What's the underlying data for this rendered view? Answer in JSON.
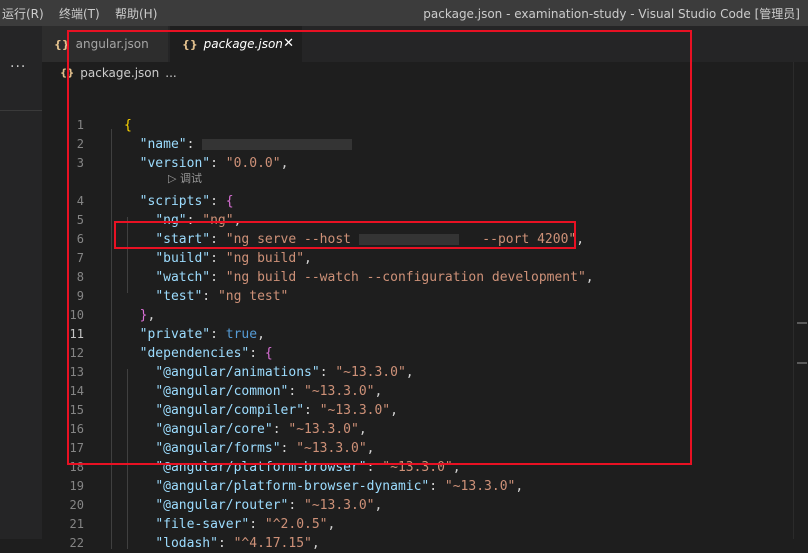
{
  "menubar": {
    "run": "运行(R)",
    "terminal": "终端(T)",
    "help": "帮助(H)"
  },
  "window_title": "package.json - examination-study - Visual Studio Code [管理员]",
  "activity": {
    "more": "···"
  },
  "tabs": [
    {
      "label": "angular.json",
      "icon": "json-braces-icon"
    },
    {
      "label": "package.json",
      "icon": "json-braces-icon",
      "close": "✕"
    }
  ],
  "breadcrumb": {
    "file": "package.json",
    "more": "..."
  },
  "braces_glyph": "{}",
  "codelens": "▷ 调试",
  "colors": {
    "string": "#ce9178",
    "key": "#9cdcfe",
    "keyword": "#569cd6",
    "bracket1": "#ffd700",
    "bracket2": "#da70d6",
    "highlight": "#e81123"
  },
  "editor": {
    "lines": [
      {
        "n": "1",
        "tokens": [
          {
            "t": "{",
            "c": "b1"
          }
        ]
      },
      {
        "n": "2",
        "tokens": [
          {
            "t": "  "
          },
          {
            "t": "\"name\"",
            "c": "key"
          },
          {
            "t": ": ",
            "c": "punc"
          },
          {
            "blur": 150
          }
        ]
      },
      {
        "n": "3",
        "tokens": [
          {
            "t": "  "
          },
          {
            "t": "\"version\"",
            "c": "key"
          },
          {
            "t": ": ",
            "c": "punc"
          },
          {
            "t": "\"0.0.0\"",
            "c": "str"
          },
          {
            "t": ",",
            "c": "punc"
          }
        ]
      },
      {
        "n": "4",
        "tokens": [
          {
            "t": "  "
          },
          {
            "t": "\"scripts\"",
            "c": "key"
          },
          {
            "t": ": ",
            "c": "punc"
          },
          {
            "t": "{",
            "c": "b2"
          }
        ]
      },
      {
        "n": "5",
        "tokens": [
          {
            "t": "    "
          },
          {
            "t": "\"ng\"",
            "c": "key"
          },
          {
            "t": ": ",
            "c": "punc"
          },
          {
            "t": "\"ng\"",
            "c": "str"
          },
          {
            "t": ",",
            "c": "punc"
          }
        ]
      },
      {
        "n": "6",
        "tokens": [
          {
            "t": "    "
          },
          {
            "t": "\"start\"",
            "c": "key"
          },
          {
            "t": ": ",
            "c": "punc"
          },
          {
            "t": "\"ng serve --host ",
            "c": "str"
          },
          {
            "blur": 100
          },
          {
            "t": "   --port 4200\"",
            "c": "str"
          },
          {
            "t": ",",
            "c": "punc"
          }
        ]
      },
      {
        "n": "7",
        "tokens": [
          {
            "t": "    "
          },
          {
            "t": "\"build\"",
            "c": "key"
          },
          {
            "t": ": ",
            "c": "punc"
          },
          {
            "t": "\"ng build\"",
            "c": "str"
          },
          {
            "t": ",",
            "c": "punc"
          }
        ]
      },
      {
        "n": "8",
        "tokens": [
          {
            "t": "    "
          },
          {
            "t": "\"watch\"",
            "c": "key"
          },
          {
            "t": ": ",
            "c": "punc"
          },
          {
            "t": "\"ng build --watch --configuration development\"",
            "c": "str"
          },
          {
            "t": ",",
            "c": "punc"
          }
        ]
      },
      {
        "n": "9",
        "tokens": [
          {
            "t": "    "
          },
          {
            "t": "\"test\"",
            "c": "key"
          },
          {
            "t": ": ",
            "c": "punc"
          },
          {
            "t": "\"ng test\"",
            "c": "str"
          }
        ]
      },
      {
        "n": "10",
        "tokens": [
          {
            "t": "  "
          },
          {
            "t": "}",
            "c": "b2"
          },
          {
            "t": ",",
            "c": "punc"
          }
        ]
      },
      {
        "n": "11",
        "tokens": [
          {
            "t": "  "
          },
          {
            "t": "\"private\"",
            "c": "key"
          },
          {
            "t": ": ",
            "c": "punc"
          },
          {
            "t": "true",
            "c": "kw"
          },
          {
            "t": ",",
            "c": "punc"
          }
        ]
      },
      {
        "n": "12",
        "tokens": [
          {
            "t": "  "
          },
          {
            "t": "\"dependencies\"",
            "c": "key"
          },
          {
            "t": ": ",
            "c": "punc"
          },
          {
            "t": "{",
            "c": "b2"
          }
        ]
      },
      {
        "n": "13",
        "tokens": [
          {
            "t": "    "
          },
          {
            "t": "\"@angular/animations\"",
            "c": "key"
          },
          {
            "t": ": ",
            "c": "punc"
          },
          {
            "t": "\"~13.3.0\"",
            "c": "str"
          },
          {
            "t": ",",
            "c": "punc"
          }
        ]
      },
      {
        "n": "14",
        "tokens": [
          {
            "t": "    "
          },
          {
            "t": "\"@angular/common\"",
            "c": "key"
          },
          {
            "t": ": ",
            "c": "punc"
          },
          {
            "t": "\"~13.3.0\"",
            "c": "str"
          },
          {
            "t": ",",
            "c": "punc"
          }
        ]
      },
      {
        "n": "15",
        "tokens": [
          {
            "t": "    "
          },
          {
            "t": "\"@angular/compiler\"",
            "c": "key"
          },
          {
            "t": ": ",
            "c": "punc"
          },
          {
            "t": "\"~13.3.0\"",
            "c": "str"
          },
          {
            "t": ",",
            "c": "punc"
          }
        ]
      },
      {
        "n": "16",
        "tokens": [
          {
            "t": "    "
          },
          {
            "t": "\"@angular/core\"",
            "c": "key"
          },
          {
            "t": ": ",
            "c": "punc"
          },
          {
            "t": "\"~13.3.0\"",
            "c": "str"
          },
          {
            "t": ",",
            "c": "punc"
          }
        ]
      },
      {
        "n": "17",
        "tokens": [
          {
            "t": "    "
          },
          {
            "t": "\"@angular/forms\"",
            "c": "key"
          },
          {
            "t": ": ",
            "c": "punc"
          },
          {
            "t": "\"~13.3.0\"",
            "c": "str"
          },
          {
            "t": ",",
            "c": "punc"
          }
        ]
      },
      {
        "n": "18",
        "tokens": [
          {
            "t": "    "
          },
          {
            "t": "\"@angular/platform-browser\"",
            "c": "key"
          },
          {
            "t": ": ",
            "c": "punc"
          },
          {
            "t": "\"~13.3.0\"",
            "c": "str"
          },
          {
            "t": ",",
            "c": "punc"
          }
        ]
      },
      {
        "n": "19",
        "tokens": [
          {
            "t": "    "
          },
          {
            "t": "\"@angular/platform-browser-dynamic\"",
            "c": "key"
          },
          {
            "t": ": ",
            "c": "punc"
          },
          {
            "t": "\"~13.3.0\"",
            "c": "str"
          },
          {
            "t": ",",
            "c": "punc"
          }
        ]
      },
      {
        "n": "20",
        "tokens": [
          {
            "t": "    "
          },
          {
            "t": "\"@angular/router\"",
            "c": "key"
          },
          {
            "t": ": ",
            "c": "punc"
          },
          {
            "t": "\"~13.3.0\"",
            "c": "str"
          },
          {
            "t": ",",
            "c": "punc"
          }
        ]
      },
      {
        "n": "21",
        "tokens": [
          {
            "t": "    "
          },
          {
            "t": "\"file-saver\"",
            "c": "key"
          },
          {
            "t": ": ",
            "c": "punc"
          },
          {
            "t": "\"^2.0.5\"",
            "c": "str"
          },
          {
            "t": ",",
            "c": "punc"
          }
        ]
      },
      {
        "n": "22",
        "tokens": [
          {
            "t": "    "
          },
          {
            "t": "\"lodash\"",
            "c": "key"
          },
          {
            "t": ": ",
            "c": "punc"
          },
          {
            "t": "\"^4.17.15\"",
            "c": "str"
          },
          {
            "t": ",",
            "c": "punc"
          }
        ]
      }
    ],
    "active_line": "11"
  }
}
